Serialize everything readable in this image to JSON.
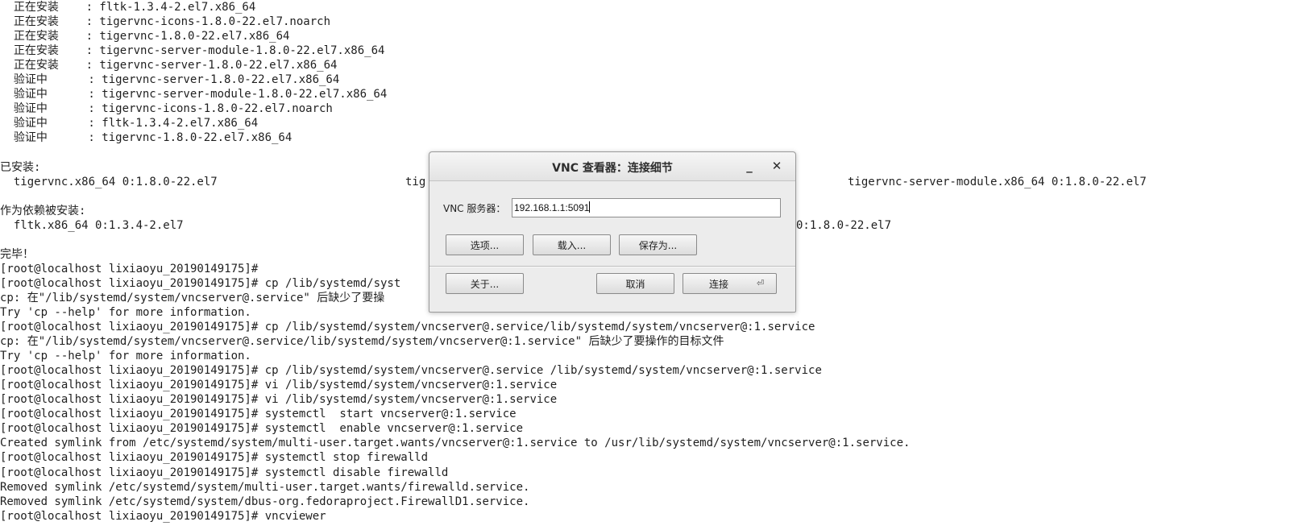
{
  "terminal": {
    "lines": [
      "  正在安装    : fltk-1.3.4-2.el7.x86_64",
      "  正在安装    : tigervnc-icons-1.8.0-22.el7.noarch",
      "  正在安装    : tigervnc-1.8.0-22.el7.x86_64",
      "  正在安装    : tigervnc-server-module-1.8.0-22.el7.x86_64",
      "  正在安装    : tigervnc-server-1.8.0-22.el7.x86_64",
      "  验证中      : tigervnc-server-1.8.0-22.el7.x86_64",
      "  验证中      : tigervnc-server-module-1.8.0-22.el7.x86_64",
      "  验证中      : tigervnc-icons-1.8.0-22.el7.noarch",
      "  验证中      : fltk-1.3.4-2.el7.x86_64",
      "  验证中      : tigervnc-1.8.0-22.el7.x86_64",
      "",
      "已安装:"
    ],
    "installed_row": {
      "col1": "  tigervnc.x86_64 0:1.8.0-22.el7",
      "col2": "tig",
      "col3": "tigervnc-server-module.x86_64 0:1.8.0-22.el7"
    },
    "lines_mid": [
      "",
      "作为依赖被安装:"
    ],
    "dep_row": {
      "col1": "  fltk.x86_64 0:1.3.4-2.el7",
      "col3": "0:1.8.0-22.el7"
    },
    "lines_after_dep": [
      "",
      "完毕！",
      "[root@localhost lixiaoyu_20190149175]# "
    ],
    "partial_1": "[root@localhost lixiaoyu_20190149175]# cp /lib/systemd/syst",
    "partial_2": "cp: 在\"/lib/systemd/system/vncserver@.service\" 后缺少了要操",
    "lines_tail": [
      "Try 'cp --help' for more information.",
      "[root@localhost lixiaoyu_20190149175]# cp /lib/systemd/system/vncserver@.service/lib/systemd/system/vncserver@:1.service",
      "cp: 在\"/lib/systemd/system/vncserver@.service/lib/systemd/system/vncserver@:1.service\" 后缺少了要操作的目标文件",
      "Try 'cp --help' for more information.",
      "[root@localhost lixiaoyu_20190149175]# cp /lib/systemd/system/vncserver@.service /lib/systemd/system/vncserver@:1.service",
      "[root@localhost lixiaoyu_20190149175]# vi /lib/systemd/system/vncserver@:1.service",
      "[root@localhost lixiaoyu_20190149175]# vi /lib/systemd/system/vncserver@:1.service",
      "[root@localhost lixiaoyu_20190149175]# systemctl  start vncserver@:1.service",
      "[root@localhost lixiaoyu_20190149175]# systemctl  enable vncserver@:1.service",
      "Created symlink from /etc/systemd/system/multi-user.target.wants/vncserver@:1.service to /usr/lib/systemd/system/vncserver@:1.service.",
      "[root@localhost lixiaoyu_20190149175]# systemctl stop firewalld",
      "[root@localhost lixiaoyu_20190149175]# systemctl disable firewalld",
      "Removed symlink /etc/systemd/system/multi-user.target.wants/firewalld.service.",
      "Removed symlink /etc/systemd/system/dbus-org.fedoraproject.FirewallD1.service.",
      "[root@localhost lixiaoyu_20190149175]# vncviewer"
    ]
  },
  "dialog": {
    "title": "VNC 查看器：连接细节",
    "minimize_glyph": "_",
    "close_glyph": "✕",
    "server_label": "VNC 服务器：",
    "server_value": "192.168.1.1:5091",
    "options_label": "选项...",
    "load_label": "载入...",
    "saveas_label": "保存为...",
    "about_label": "关于...",
    "cancel_label": "取消",
    "connect_label": "连接",
    "connect_icon_glyph": "⏎"
  }
}
